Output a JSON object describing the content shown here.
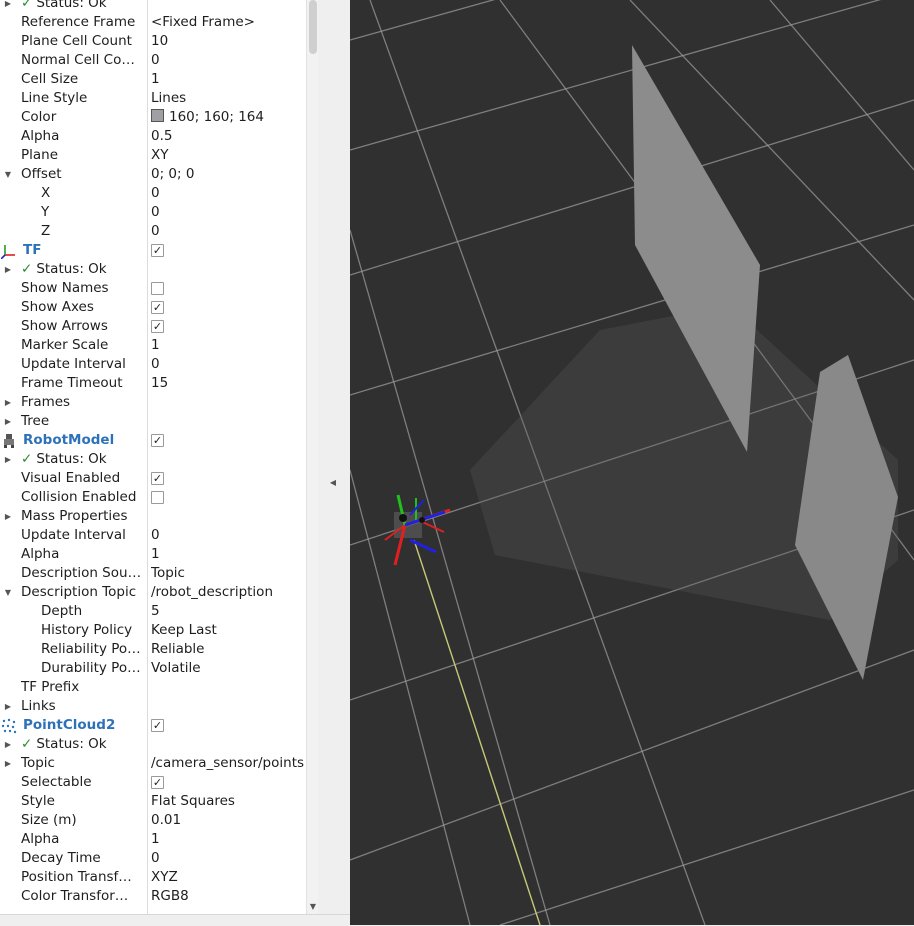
{
  "tree": [
    {
      "indent": 0,
      "arrow": "right",
      "status": true,
      "name": "Status: Ok",
      "value": ""
    },
    {
      "indent": 0,
      "name": "Reference Frame",
      "value": "<Fixed Frame>"
    },
    {
      "indent": 0,
      "name": "Plane Cell Count",
      "value": "10"
    },
    {
      "indent": 0,
      "name": "Normal Cell Co…",
      "value": "0"
    },
    {
      "indent": 0,
      "name": "Cell Size",
      "value": "1"
    },
    {
      "indent": 0,
      "name": "Line Style",
      "value": "Lines"
    },
    {
      "indent": 0,
      "name": "Color",
      "value": "160; 160; 164",
      "swatch": "#a0a0a4"
    },
    {
      "indent": 0,
      "name": "Alpha",
      "value": "0.5"
    },
    {
      "indent": 0,
      "name": "Plane",
      "value": "XY"
    },
    {
      "indent": 0,
      "arrow": "down",
      "name": "Offset",
      "value": "0; 0; 0"
    },
    {
      "indent": 1,
      "name": "X",
      "value": "0"
    },
    {
      "indent": 1,
      "name": "Y",
      "value": "0"
    },
    {
      "indent": 1,
      "name": "Z",
      "value": "0"
    },
    {
      "display": true,
      "icon": "tf-axes-icon",
      "name": "TF",
      "checkbox": true
    },
    {
      "indent": 0,
      "arrow": "right",
      "status": true,
      "name": "Status: Ok",
      "value": ""
    },
    {
      "indent": 0,
      "name": "Show Names",
      "checkbox": false
    },
    {
      "indent": 0,
      "name": "Show Axes",
      "checkbox": true
    },
    {
      "indent": 0,
      "name": "Show Arrows",
      "checkbox": true
    },
    {
      "indent": 0,
      "name": "Marker Scale",
      "value": "1"
    },
    {
      "indent": 0,
      "name": "Update Interval",
      "value": "0"
    },
    {
      "indent": 0,
      "name": "Frame Timeout",
      "value": "15"
    },
    {
      "indent": 0,
      "arrow": "right",
      "name": "Frames",
      "value": ""
    },
    {
      "indent": 0,
      "arrow": "right",
      "name": "Tree",
      "value": ""
    },
    {
      "display": true,
      "icon": "robot-model-icon",
      "name": "RobotModel",
      "checkbox": true
    },
    {
      "indent": 0,
      "arrow": "right",
      "status": true,
      "name": "Status: Ok",
      "value": ""
    },
    {
      "indent": 0,
      "name": "Visual Enabled",
      "checkbox": true
    },
    {
      "indent": 0,
      "name": "Collision Enabled",
      "checkbox": false
    },
    {
      "indent": 0,
      "arrow": "right",
      "name": "Mass Properties",
      "value": ""
    },
    {
      "indent": 0,
      "name": "Update Interval",
      "value": "0"
    },
    {
      "indent": 0,
      "name": "Alpha",
      "value": "1"
    },
    {
      "indent": 0,
      "name": "Description Sou…",
      "value": "Topic"
    },
    {
      "indent": 0,
      "arrow": "down",
      "name": "Description Topic",
      "value": "/robot_description"
    },
    {
      "indent": 1,
      "name": "Depth",
      "value": "5"
    },
    {
      "indent": 1,
      "name": "History Policy",
      "value": "Keep Last"
    },
    {
      "indent": 1,
      "name": "Reliability Po…",
      "value": "Reliable"
    },
    {
      "indent": 1,
      "name": "Durability Po…",
      "value": "Volatile"
    },
    {
      "indent": 0,
      "name": "TF Prefix",
      "value": ""
    },
    {
      "indent": 0,
      "arrow": "right",
      "name": "Links",
      "value": ""
    },
    {
      "display": true,
      "icon": "point-cloud-icon",
      "name": "PointCloud2",
      "checkbox": true
    },
    {
      "indent": 0,
      "arrow": "right",
      "status": true,
      "name": "Status: Ok",
      "value": ""
    },
    {
      "indent": 0,
      "arrow": "right",
      "name": "Topic",
      "value": "/camera_sensor/points"
    },
    {
      "indent": 0,
      "name": "Selectable",
      "checkbox": true
    },
    {
      "indent": 0,
      "name": "Style",
      "value": "Flat Squares"
    },
    {
      "indent": 0,
      "name": "Size (m)",
      "value": "0.01"
    },
    {
      "indent": 0,
      "name": "Alpha",
      "value": "1"
    },
    {
      "indent": 0,
      "name": "Decay Time",
      "value": "0"
    },
    {
      "indent": 0,
      "name": "Position Transf…",
      "value": "XYZ"
    },
    {
      "indent": 0,
      "name": "Color Transfor…",
      "value": "RGB8"
    }
  ],
  "colors": {
    "viewport_background": "#303030",
    "grid_lines": "#a0a0a4",
    "display_name": "#2d72b8",
    "status_check": "#2e8b2e",
    "point_cloud": "#8a8a8a",
    "tf_x_axis": "#e02020",
    "tf_y_axis": "#20c020",
    "tf_z_axis": "#2020e0"
  }
}
